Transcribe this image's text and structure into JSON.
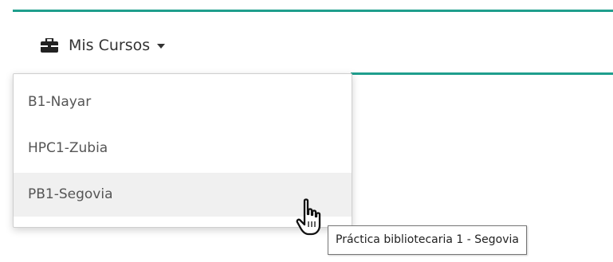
{
  "menu": {
    "label": "Mis Cursos",
    "icon": "briefcase-icon",
    "caret_icon": "caret-down-icon"
  },
  "dropdown": {
    "items": [
      {
        "label": "B1-Nayar"
      },
      {
        "label": "HPC1-Zubia"
      },
      {
        "label": "PB1-Segovia",
        "hovered": true
      }
    ]
  },
  "tooltip": {
    "text": "Práctica bibliotecaria 1 - Segovia"
  },
  "cursor": {
    "type": "hand-pointer-icon"
  },
  "colors": {
    "accent": "#1f9e8d",
    "text": "#333333",
    "hover": "#f0f0f0"
  }
}
